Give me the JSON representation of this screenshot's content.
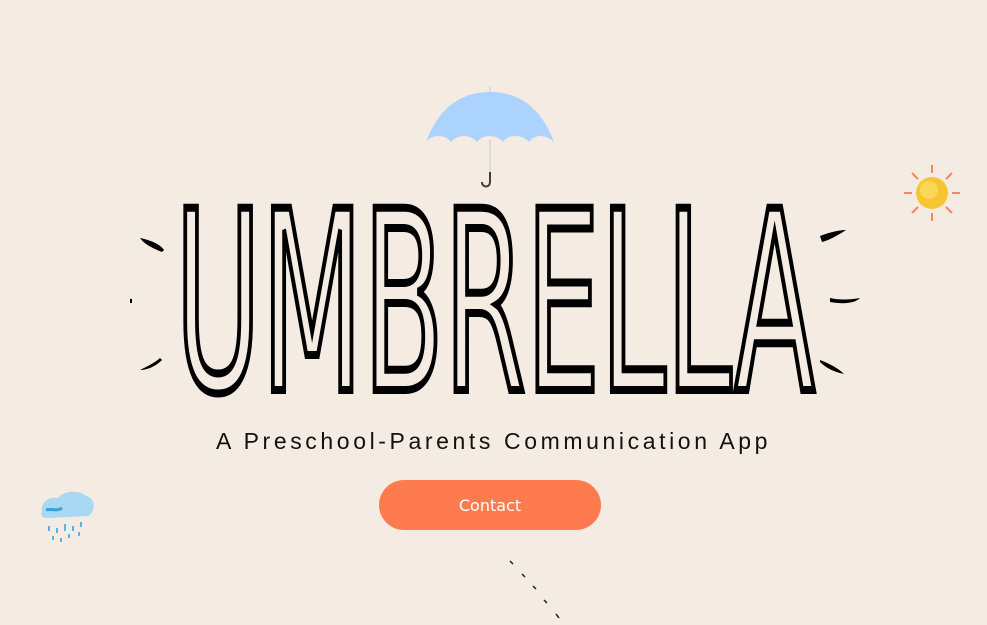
{
  "hero": {
    "title": "UMBRELLA",
    "subtitle": "A Preschool-Parents Communication App",
    "contact_label": "Contact"
  },
  "colors": {
    "background": "#f4ebe2",
    "button": "#fe7a4f",
    "umbrella": "#acd3fd",
    "title": "#000000"
  },
  "icons": [
    "umbrella-icon",
    "sun-icon",
    "rain-cloud-icon",
    "scroll-dashes"
  ]
}
